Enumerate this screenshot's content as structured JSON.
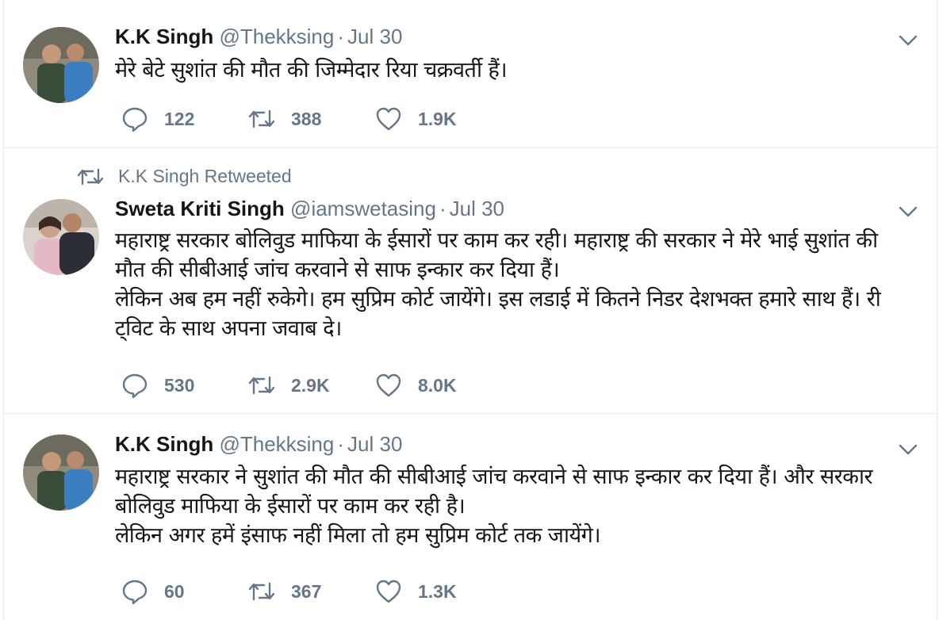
{
  "tweets": [
    {
      "name": "K.K Singh",
      "handle": "@Thekksing",
      "date": "Jul 30",
      "text": "मेरे बेटे सुशांत की मौत की जिम्मेदार रिया चक्रवर्ती हैं।",
      "replies": "122",
      "retweets": "388",
      "likes": "1.9K"
    },
    {
      "context": "K.K Singh Retweeted",
      "name": "Sweta Kriti Singh",
      "handle": "@iamswetasing",
      "date": "Jul 30",
      "text": "महाराष्ट्र सरकार बोलिवुड माफिया के ईसारों पर काम कर रही। महाराष्ट्र की सरकार ने मेरे भाई सुशांत की मौत की सीबीआई जांच करवाने से साफ इन्कार कर दिया हैं।\nलेकिन अब हम नहीं रुकेगे। हम सुप्रिम कोर्ट जायेंगे। इस लडाई में कितने निडर देशभक्त हमारे साथ हैं। री ट्विट के साथ अपना जवाब दे।",
      "replies": "530",
      "retweets": "2.9K",
      "likes": "8.0K"
    },
    {
      "name": "K.K Singh",
      "handle": "@Thekksing",
      "date": "Jul 30",
      "text": "महाराष्ट्र सरकार ने सुशांत की मौत की सीबीआई जांच करवाने से साफ इन्कार कर दिया हैं। और सरकार बोलिवुड माफिया के ईसारों पर काम कर रही है।\nलेकिन अगर हमें इंसाफ नहीं मिला तो हम सुप्रिम कोर्ट तक जायेंगे।",
      "replies": "60",
      "retweets": "367",
      "likes": "1.3K"
    }
  ],
  "icons": {
    "reply": "reply-icon",
    "retweet": "retweet-icon",
    "like": "heart-icon",
    "more": "chevron-down-icon"
  },
  "colors": {
    "text": "#14171a",
    "secondary": "#657786",
    "divider": "#e6ecf0"
  }
}
